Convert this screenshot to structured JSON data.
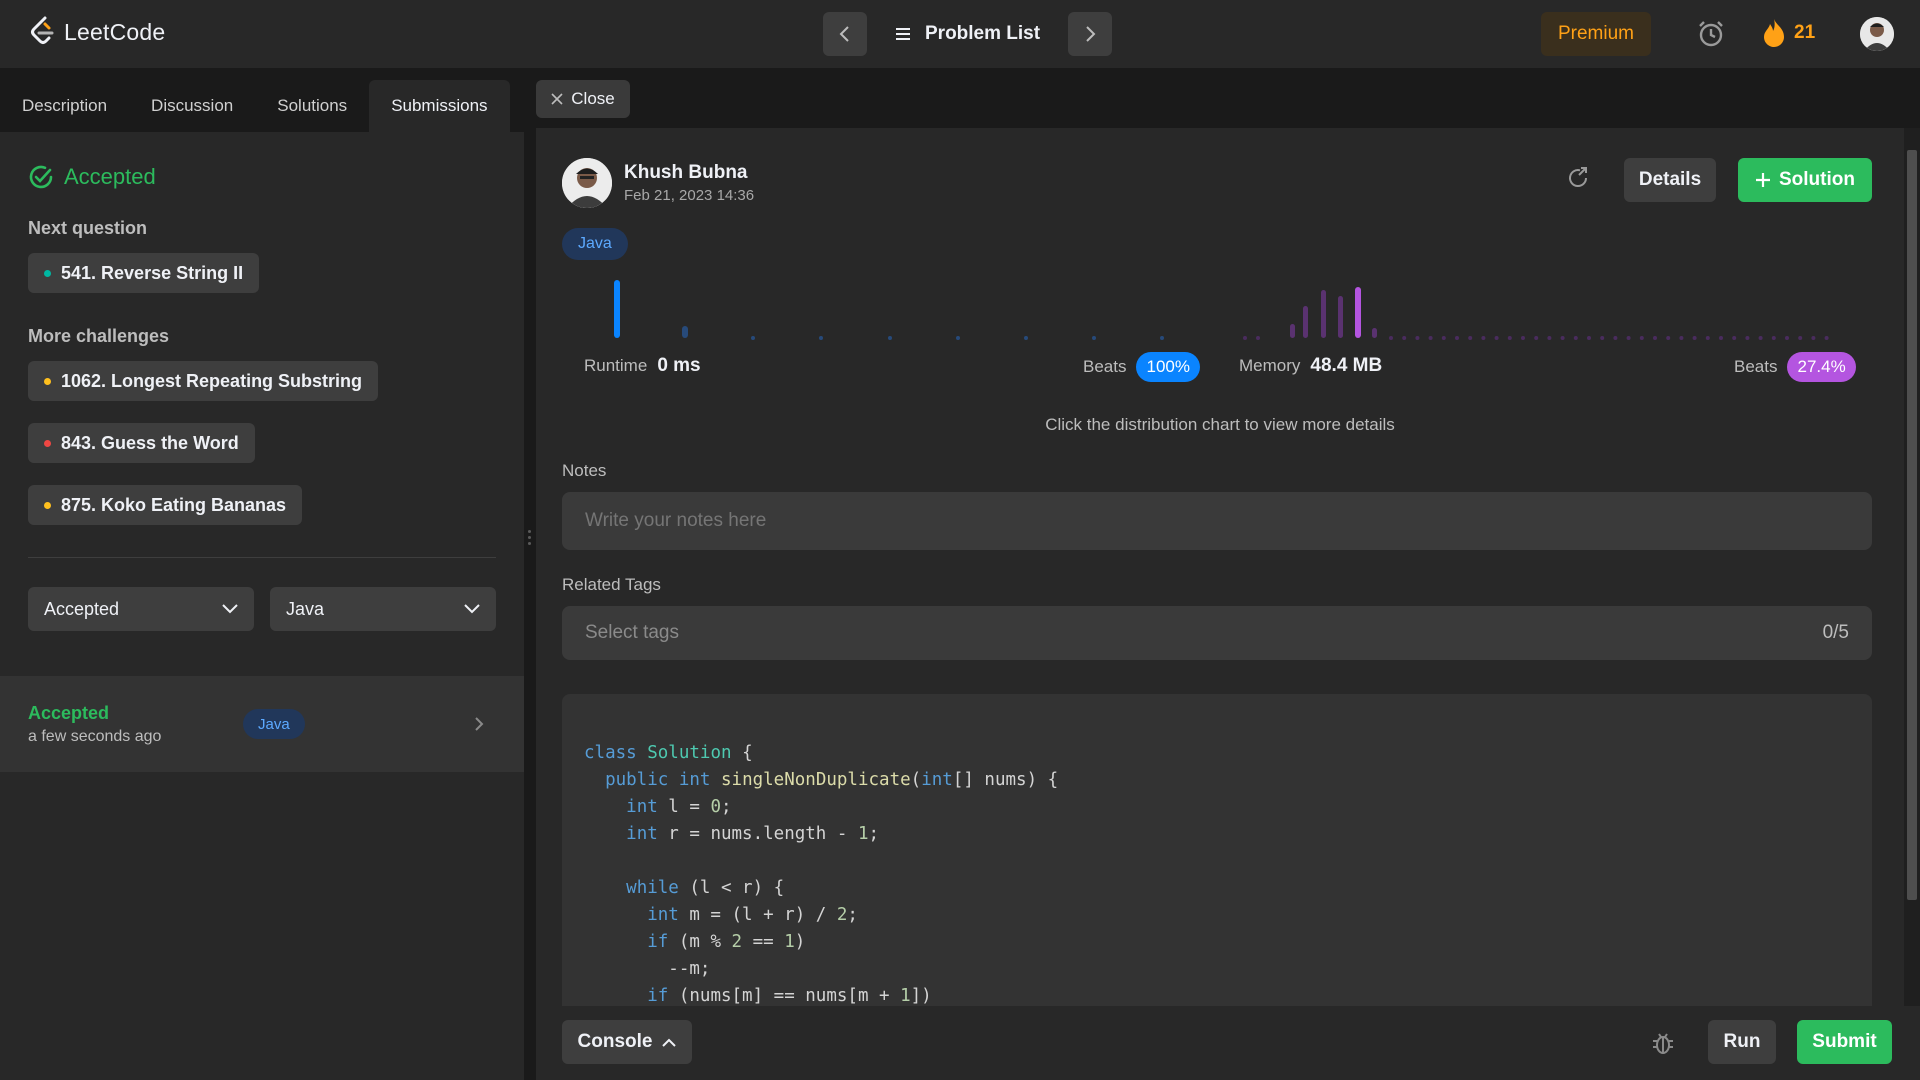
{
  "header": {
    "logo_text": "LeetCode",
    "problem_list_label": "Problem List",
    "premium_label": "Premium",
    "streak_count": "21"
  },
  "left": {
    "tabs": [
      {
        "label": "Description"
      },
      {
        "label": "Discussion"
      },
      {
        "label": "Solutions"
      },
      {
        "label": "Submissions"
      }
    ],
    "status": "Accepted",
    "next_question_label": "Next question",
    "next_question": {
      "title": "541. Reverse String II",
      "difficulty_color": "#00b8a3"
    },
    "more_challenges_label": "More challenges",
    "challenges": [
      {
        "title": "1062. Longest Repeating Substring",
        "difficulty_color": "#ffc01e"
      },
      {
        "title": "843. Guess the Word",
        "difficulty_color": "#ef4743"
      },
      {
        "title": "875. Koko Eating Bananas",
        "difficulty_color": "#ffc01e"
      }
    ],
    "filter_status": "Accepted",
    "filter_language": "Java",
    "submission": {
      "status": "Accepted",
      "time": "a few seconds ago",
      "language": "Java"
    }
  },
  "right": {
    "close_label": "Close",
    "user_name": "Khush Bubna",
    "date": "Feb 21, 2023 14:36",
    "details_label": "Details",
    "solution_label": "Solution",
    "language_tag": "Java",
    "runtime_label": "Runtime",
    "runtime_value": "0 ms",
    "runtime_beats_label": "Beats",
    "runtime_beats": "100%",
    "memory_label": "Memory",
    "memory_value": "48.4 MB",
    "memory_beats_label": "Beats",
    "memory_beats": "27.4%",
    "chart_hint": "Click the distribution chart to view more details",
    "notes_label": "Notes",
    "notes_placeholder": "Write your notes here",
    "tags_label": "Related Tags",
    "tags_placeholder": "Select tags",
    "tags_count": "0/5",
    "code_lines": [
      "class Solution {",
      "  public int singleNonDuplicate(int[] nums) {",
      "    int l = 0;",
      "    int r = nums.length - 1;",
      "",
      "    while (l < r) {",
      "      int m = (l + r) / 2;",
      "      if (m % 2 == 1)",
      "        --m;",
      "      if (nums[m] == nums[m + 1])"
    ]
  },
  "footer": {
    "console_label": "Console",
    "run_label": "Run",
    "submit_label": "Submit"
  },
  "colors": {
    "accent_green": "#2cbb5d",
    "premium_orange": "#ffa116",
    "runtime_blue": "#0a84ff",
    "memory_purple": "#b455e0"
  }
}
